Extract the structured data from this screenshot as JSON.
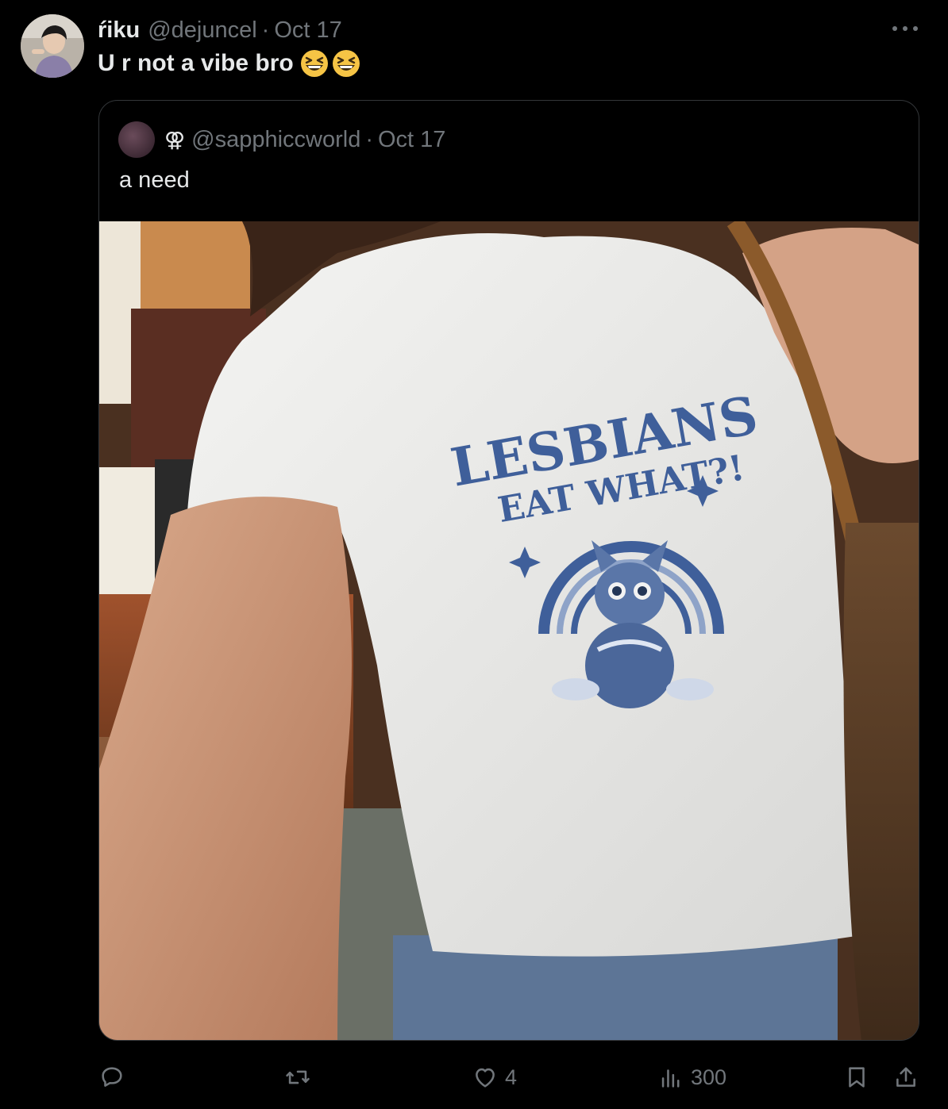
{
  "tweet": {
    "author_name": "ŕiku",
    "author_handle": "@dejuncel",
    "separator": "·",
    "date": "Oct 17",
    "text": "U r not a vibe bro",
    "emojis": [
      "grinning-squinting-face",
      "grinning-squinting-face"
    ]
  },
  "quoted": {
    "symbol": "⚢",
    "handle": "@sapphiccworld",
    "separator": "·",
    "date": "Oct 17",
    "text": "a need",
    "image": {
      "shirt_text_line1": "LESBIANS",
      "shirt_text_line2": "EAT WHAT?!",
      "shirt_ink_color": "#3f5f9a"
    }
  },
  "actions": {
    "reply_icon": "reply-icon",
    "repost_icon": "repost-icon",
    "like_icon": "heart-icon",
    "like_count": "4",
    "views_icon": "analytics-icon",
    "views_count": "300",
    "bookmark_icon": "bookmark-icon",
    "share_icon": "share-icon"
  },
  "colors": {
    "background": "#000000",
    "text_primary": "#e7e9ea",
    "text_secondary": "#71767b",
    "border": "#333639"
  }
}
